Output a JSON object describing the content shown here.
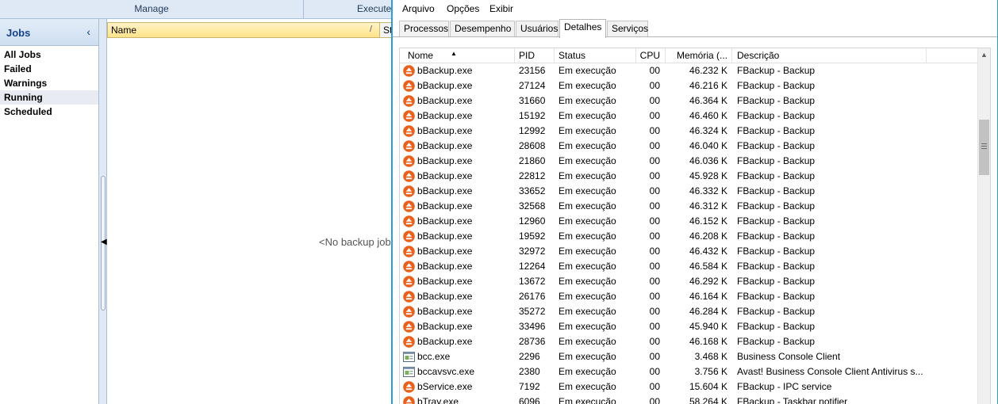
{
  "background_app": {
    "ribbon_tabs": {
      "manage": "Manage",
      "execute": "Execute"
    },
    "sidebar": {
      "title": "Jobs",
      "collapse_glyph": "‹",
      "items": [
        {
          "label": "All Jobs"
        },
        {
          "label": "Failed"
        },
        {
          "label": "Warnings"
        },
        {
          "label": "Running"
        },
        {
          "label": "Scheduled"
        }
      ]
    },
    "list": {
      "column_name": "Name",
      "column_sort_glyph": "/",
      "column_status_partial": "St",
      "empty_message": "<No backup jobs"
    }
  },
  "task_manager": {
    "menu": [
      "Arquivo",
      "Opções",
      "Exibir"
    ],
    "tabs": [
      "Processos",
      "Desempenho",
      "Usuários",
      "Detalhes",
      "Serviços"
    ],
    "active_tab": "Detalhes",
    "columns": {
      "name": "Nome",
      "pid": "PID",
      "status": "Status",
      "cpu": "CPU",
      "memory": "Memória (...",
      "description": "Descrição"
    },
    "icons": {
      "fbackup": "fbackup-orange-icon",
      "console": "console-window-icon",
      "fbackup_color": "#e8601c"
    },
    "rows": [
      {
        "icon": "fbackup",
        "name": "bBackup.exe",
        "pid": "23156",
        "status": "Em execução",
        "cpu": "00",
        "memory": "46.232 K",
        "description": "FBackup - Backup"
      },
      {
        "icon": "fbackup",
        "name": "bBackup.exe",
        "pid": "27124",
        "status": "Em execução",
        "cpu": "00",
        "memory": "46.216 K",
        "description": "FBackup - Backup"
      },
      {
        "icon": "fbackup",
        "name": "bBackup.exe",
        "pid": "31660",
        "status": "Em execução",
        "cpu": "00",
        "memory": "46.364 K",
        "description": "FBackup - Backup"
      },
      {
        "icon": "fbackup",
        "name": "bBackup.exe",
        "pid": "15192",
        "status": "Em execução",
        "cpu": "00",
        "memory": "46.460 K",
        "description": "FBackup - Backup"
      },
      {
        "icon": "fbackup",
        "name": "bBackup.exe",
        "pid": "12992",
        "status": "Em execução",
        "cpu": "00",
        "memory": "46.324 K",
        "description": "FBackup - Backup"
      },
      {
        "icon": "fbackup",
        "name": "bBackup.exe",
        "pid": "28608",
        "status": "Em execução",
        "cpu": "00",
        "memory": "46.040 K",
        "description": "FBackup - Backup"
      },
      {
        "icon": "fbackup",
        "name": "bBackup.exe",
        "pid": "21860",
        "status": "Em execução",
        "cpu": "00",
        "memory": "46.036 K",
        "description": "FBackup - Backup"
      },
      {
        "icon": "fbackup",
        "name": "bBackup.exe",
        "pid": "22812",
        "status": "Em execução",
        "cpu": "00",
        "memory": "45.928 K",
        "description": "FBackup - Backup"
      },
      {
        "icon": "fbackup",
        "name": "bBackup.exe",
        "pid": "33652",
        "status": "Em execução",
        "cpu": "00",
        "memory": "46.332 K",
        "description": "FBackup - Backup"
      },
      {
        "icon": "fbackup",
        "name": "bBackup.exe",
        "pid": "32568",
        "status": "Em execução",
        "cpu": "00",
        "memory": "46.312 K",
        "description": "FBackup - Backup"
      },
      {
        "icon": "fbackup",
        "name": "bBackup.exe",
        "pid": "12960",
        "status": "Em execução",
        "cpu": "00",
        "memory": "46.152 K",
        "description": "FBackup - Backup"
      },
      {
        "icon": "fbackup",
        "name": "bBackup.exe",
        "pid": "19592",
        "status": "Em execução",
        "cpu": "00",
        "memory": "46.208 K",
        "description": "FBackup - Backup"
      },
      {
        "icon": "fbackup",
        "name": "bBackup.exe",
        "pid": "32972",
        "status": "Em execução",
        "cpu": "00",
        "memory": "46.432 K",
        "description": "FBackup - Backup"
      },
      {
        "icon": "fbackup",
        "name": "bBackup.exe",
        "pid": "12264",
        "status": "Em execução",
        "cpu": "00",
        "memory": "46.584 K",
        "description": "FBackup - Backup"
      },
      {
        "icon": "fbackup",
        "name": "bBackup.exe",
        "pid": "13672",
        "status": "Em execução",
        "cpu": "00",
        "memory": "46.292 K",
        "description": "FBackup - Backup"
      },
      {
        "icon": "fbackup",
        "name": "bBackup.exe",
        "pid": "26176",
        "status": "Em execução",
        "cpu": "00",
        "memory": "46.164 K",
        "description": "FBackup - Backup"
      },
      {
        "icon": "fbackup",
        "name": "bBackup.exe",
        "pid": "35272",
        "status": "Em execução",
        "cpu": "00",
        "memory": "46.284 K",
        "description": "FBackup - Backup"
      },
      {
        "icon": "fbackup",
        "name": "bBackup.exe",
        "pid": "33496",
        "status": "Em execução",
        "cpu": "00",
        "memory": "45.940 K",
        "description": "FBackup - Backup"
      },
      {
        "icon": "fbackup",
        "name": "bBackup.exe",
        "pid": "28736",
        "status": "Em execução",
        "cpu": "00",
        "memory": "46.168 K",
        "description": "FBackup - Backup"
      },
      {
        "icon": "console",
        "name": "bcc.exe",
        "pid": "2296",
        "status": "Em execução",
        "cpu": "00",
        "memory": "3.468 K",
        "description": "Business Console Client"
      },
      {
        "icon": "console",
        "name": "bccavsvc.exe",
        "pid": "2380",
        "status": "Em execução",
        "cpu": "00",
        "memory": "3.756 K",
        "description": "Avast! Business Console Client Antivirus s..."
      },
      {
        "icon": "fbackup",
        "name": "bService.exe",
        "pid": "7192",
        "status": "Em execução",
        "cpu": "00",
        "memory": "15.604 K",
        "description": "FBackup - IPC service"
      },
      {
        "icon": "fbackup",
        "name": "bTray.exe",
        "pid": "6096",
        "status": "Em execução",
        "cpu": "00",
        "memory": "58.264 K",
        "description": "FBackup - Taskbar notifier"
      }
    ],
    "scrollbar": {
      "up_glyph": "▲"
    }
  }
}
